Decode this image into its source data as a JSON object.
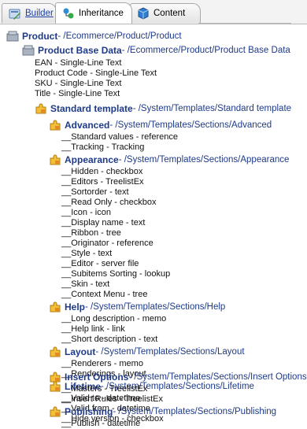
{
  "tabs": [
    {
      "label": "Builder",
      "icon": "builder-icon",
      "active": false
    },
    {
      "label": "Inheritance",
      "icon": "inheritance-icon",
      "active": true
    },
    {
      "label": "Content",
      "icon": "content-icon",
      "active": false
    }
  ],
  "tree": {
    "product": {
      "name": "Product",
      "path": " - /Ecommerce/Product/Product"
    },
    "base": {
      "name": "Product Base Data",
      "path": " - /Ecommerce/Product/Product Base Data",
      "fields": [
        "EAN - Single-Line Text",
        "Product Code - Single-Line Text",
        "SKU - Single-Line Text",
        "Title - Single-Line Text"
      ]
    },
    "standard": {
      "name": "Standard template",
      "path": " - /System/Templates/Standard template"
    },
    "sections": [
      {
        "name": "Advanced",
        "path": " - /System/Templates/Sections/Advanced",
        "fields": [
          "__Standard values - reference",
          "__Tracking - Tracking"
        ]
      },
      {
        "name": "Appearance",
        "path": " - /System/Templates/Sections/Appearance",
        "fields": [
          "__Hidden - checkbox",
          "__Editors - TreelistEx",
          "__Sortorder - text",
          "__Read Only - checkbox",
          "__Icon - icon",
          "__Display name - text",
          "__Ribbon - tree",
          "__Originator - reference",
          "__Style - text",
          "__Editor - server file",
          "__Subitems Sorting - lookup",
          "__Skin - text",
          "__Context Menu - tree"
        ]
      },
      {
        "name": "Help",
        "path": " - /System/Templates/Sections/Help",
        "fields": [
          "__Long description - memo",
          "__Help link - link",
          "__Short description - text"
        ]
      },
      {
        "name": "Layout",
        "path": " - /System/Templates/Sections/Layout",
        "fields": [
          "__Renderers - memo",
          "__Renderings - layout"
        ]
      },
      {
        "name": "Lifetime",
        "path": " - /System/Templates/Sections/Lifetime",
        "fields": [
          "__Valid to - datetime",
          "__Valid from - datetime",
          "__Hide version - checkbox"
        ]
      },
      {
        "name": "Insert Options",
        "path": " - /System/Templates/Sections/Insert Options",
        "fields": [
          "__Masters - TreelistEx",
          "__Insert Rules - TreelistEx"
        ]
      },
      {
        "name": "Publishing",
        "path": " - /System/Templates/Sections/Publishing",
        "fields": [
          "__Publish - datetime"
        ]
      }
    ]
  }
}
